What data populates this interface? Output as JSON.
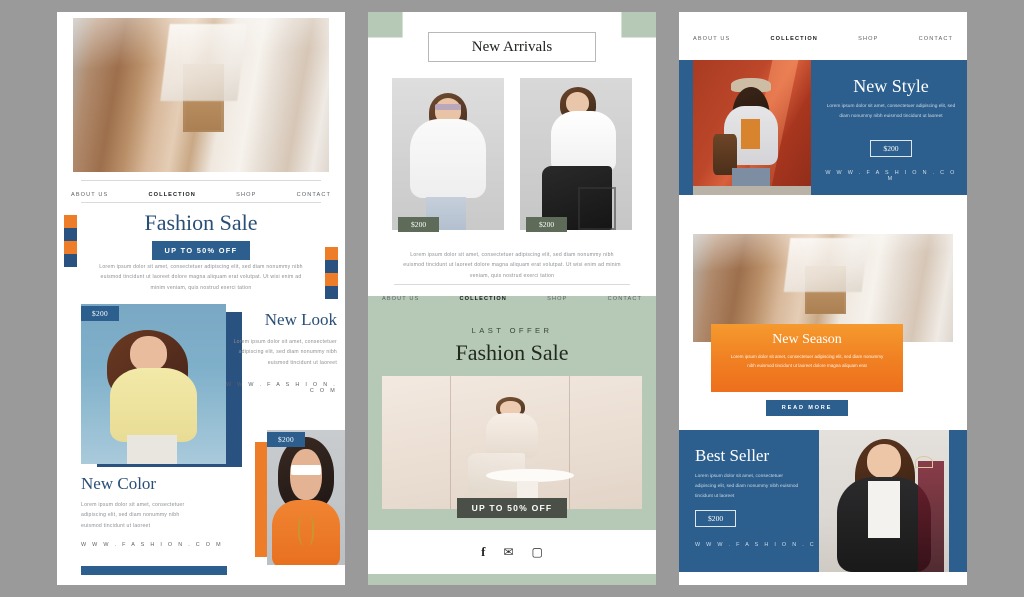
{
  "panel1": {
    "nav": [
      {
        "label": "ABOUT US",
        "active": false
      },
      {
        "label": "COLLECTION",
        "active": true
      },
      {
        "label": "SHOP",
        "active": false
      },
      {
        "label": "CONTACT",
        "active": false
      }
    ],
    "headline": "Fashion Sale",
    "cta": "UP TO 50% OFF",
    "body": "Lorem ipsum dolor sit amet, consectetuer adipiscing elit, sed diam nonummy nibh euismod tincidunt ut laoreet dolore magna aliquam erat volutpat. Ut wisi enim ad minim veniam, quis nostrud exerci tation",
    "look": {
      "price": "$200",
      "title": "New Look",
      "body": "Lorem ipsum dolor sit amet, consectetuer adipiscing elit, sed diam nonummy nibh euismod tincidunt ut laoreet",
      "url": "W W W . F A S H I O N . C O M"
    },
    "color": {
      "price": "$200",
      "title": "New Color",
      "body": "Lorem ipsum dolor sit amet, consectetuer adipiscing elit, sed diam nonummy nibh euismod tincidunt ut laoreet",
      "url": "W W W . F A S H I O N . C O M"
    }
  },
  "panel2": {
    "title": "New Arrivals",
    "products": [
      {
        "price": "$200"
      },
      {
        "price": "$200"
      }
    ],
    "body": "Lorem ipsum dolor sit amet, consectetuer adipiscing elit, sed diam nonummy nibh euismod tincidunt ut laoreet dolore magna aliquam erat volutpat. Ut wisi enim ad minim veniam, quis nostrud exerci tation",
    "nav": [
      {
        "label": "ABOUT US",
        "active": false
      },
      {
        "label": "COLLECTION",
        "active": true
      },
      {
        "label": "SHOP",
        "active": false
      },
      {
        "label": "CONTACT",
        "active": false
      }
    ],
    "eyebrow": "LAST OFFER",
    "headline": "Fashion Sale",
    "cta": "UP TO 50% OFF",
    "social": [
      "facebook-icon",
      "twitter-icon",
      "instagram-icon"
    ]
  },
  "panel3": {
    "nav": [
      {
        "label": "ABOUT US",
        "active": false
      },
      {
        "label": "COLLECTION",
        "active": true
      },
      {
        "label": "SHOP",
        "active": false
      },
      {
        "label": "CONTACT",
        "active": false
      }
    ],
    "style": {
      "title": "New Style",
      "body": "Lorem ipsum dolor sit amet, consectetuer adipiscing elit, sed diam nonummy nibh euismod tincidunt ut laoreet",
      "price": "$200",
      "url": "W W W . F A S H I O N . C O M"
    },
    "season": {
      "title": "New Season",
      "body": "Lorem ipsum dolor sit amet, consectetuer adipiscing elit, sed diam nonummy nibh euismod tincidunt ut laoreet dolore magna aliquam erat",
      "button": "READ MORE"
    },
    "seller": {
      "title": "Best Seller",
      "body": "Lorem ipsum dolor sit amet, consectetuer adipiscing elit, sed diam nonummy nibh euismod tincidunt ut laoreet",
      "price": "$200",
      "url": "W W W . F A S H I O N . C O M"
    }
  },
  "colors": {
    "blue": "#2c5f8d",
    "deep_blue": "#2a5280",
    "orange": "#ee7d2a",
    "sage": "#b6c9b6",
    "olive": "#5d6b58",
    "dark": "#4a4f47"
  }
}
